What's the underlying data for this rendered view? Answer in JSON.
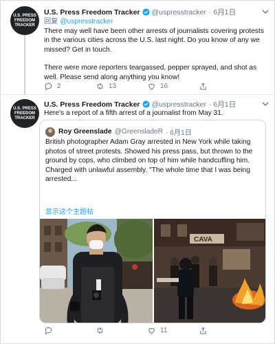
{
  "tweet1": {
    "avatar_lines": [
      "U.S. PRESS",
      "FREEDOM",
      "TRACKER"
    ],
    "name": "U.S. Press Freedom Tracker",
    "handle": "@uspresstracker",
    "date": "· 6月1日",
    "reply_label": "回复",
    "reply_to": "@uspresstracker",
    "text1": "There may well have been other arrests of journalists covering protests in the various cities across the U.S. last night. Do you know of any we missed? Get in touch.",
    "text2": "There were more reporters teargassed, pepper sprayed, and shot as well. Please send along anything you know!",
    "replies": "2",
    "retweets": "13",
    "likes": "16"
  },
  "tweet2": {
    "avatar_lines": [
      "U.S. PRESS",
      "FREEDOM",
      "TRACKER"
    ],
    "name": "U.S. Press Freedom Tracker",
    "handle": "@uspresstracker",
    "date": "· 6月1日",
    "text": "Here's a report of a fifth arrest of a journalist from May 31.",
    "quote": {
      "name": "Roy Greenslade",
      "handle": "@GreensladeR",
      "date": "· 6月1日",
      "text": "British photographer Adam Gray arrested in New York while taking photos of street protests. Showed his press pass, but thrown to the ground by cops, who climbed on top of him while handcuffing him. Charged with unlawful assembly. \"The whole time that I was being arrested...",
      "show_thread": "显示这个主题帖"
    },
    "replies": "",
    "retweets": "",
    "likes": "11"
  },
  "colors": {
    "accent": "#1da1f2",
    "muted": "#657786",
    "text": "#14171a",
    "border": "#e6ecf0"
  },
  "icons": [
    "verified-badge-icon",
    "chevron-down-icon",
    "reply-icon",
    "retweet-icon",
    "like-icon",
    "share-icon"
  ]
}
